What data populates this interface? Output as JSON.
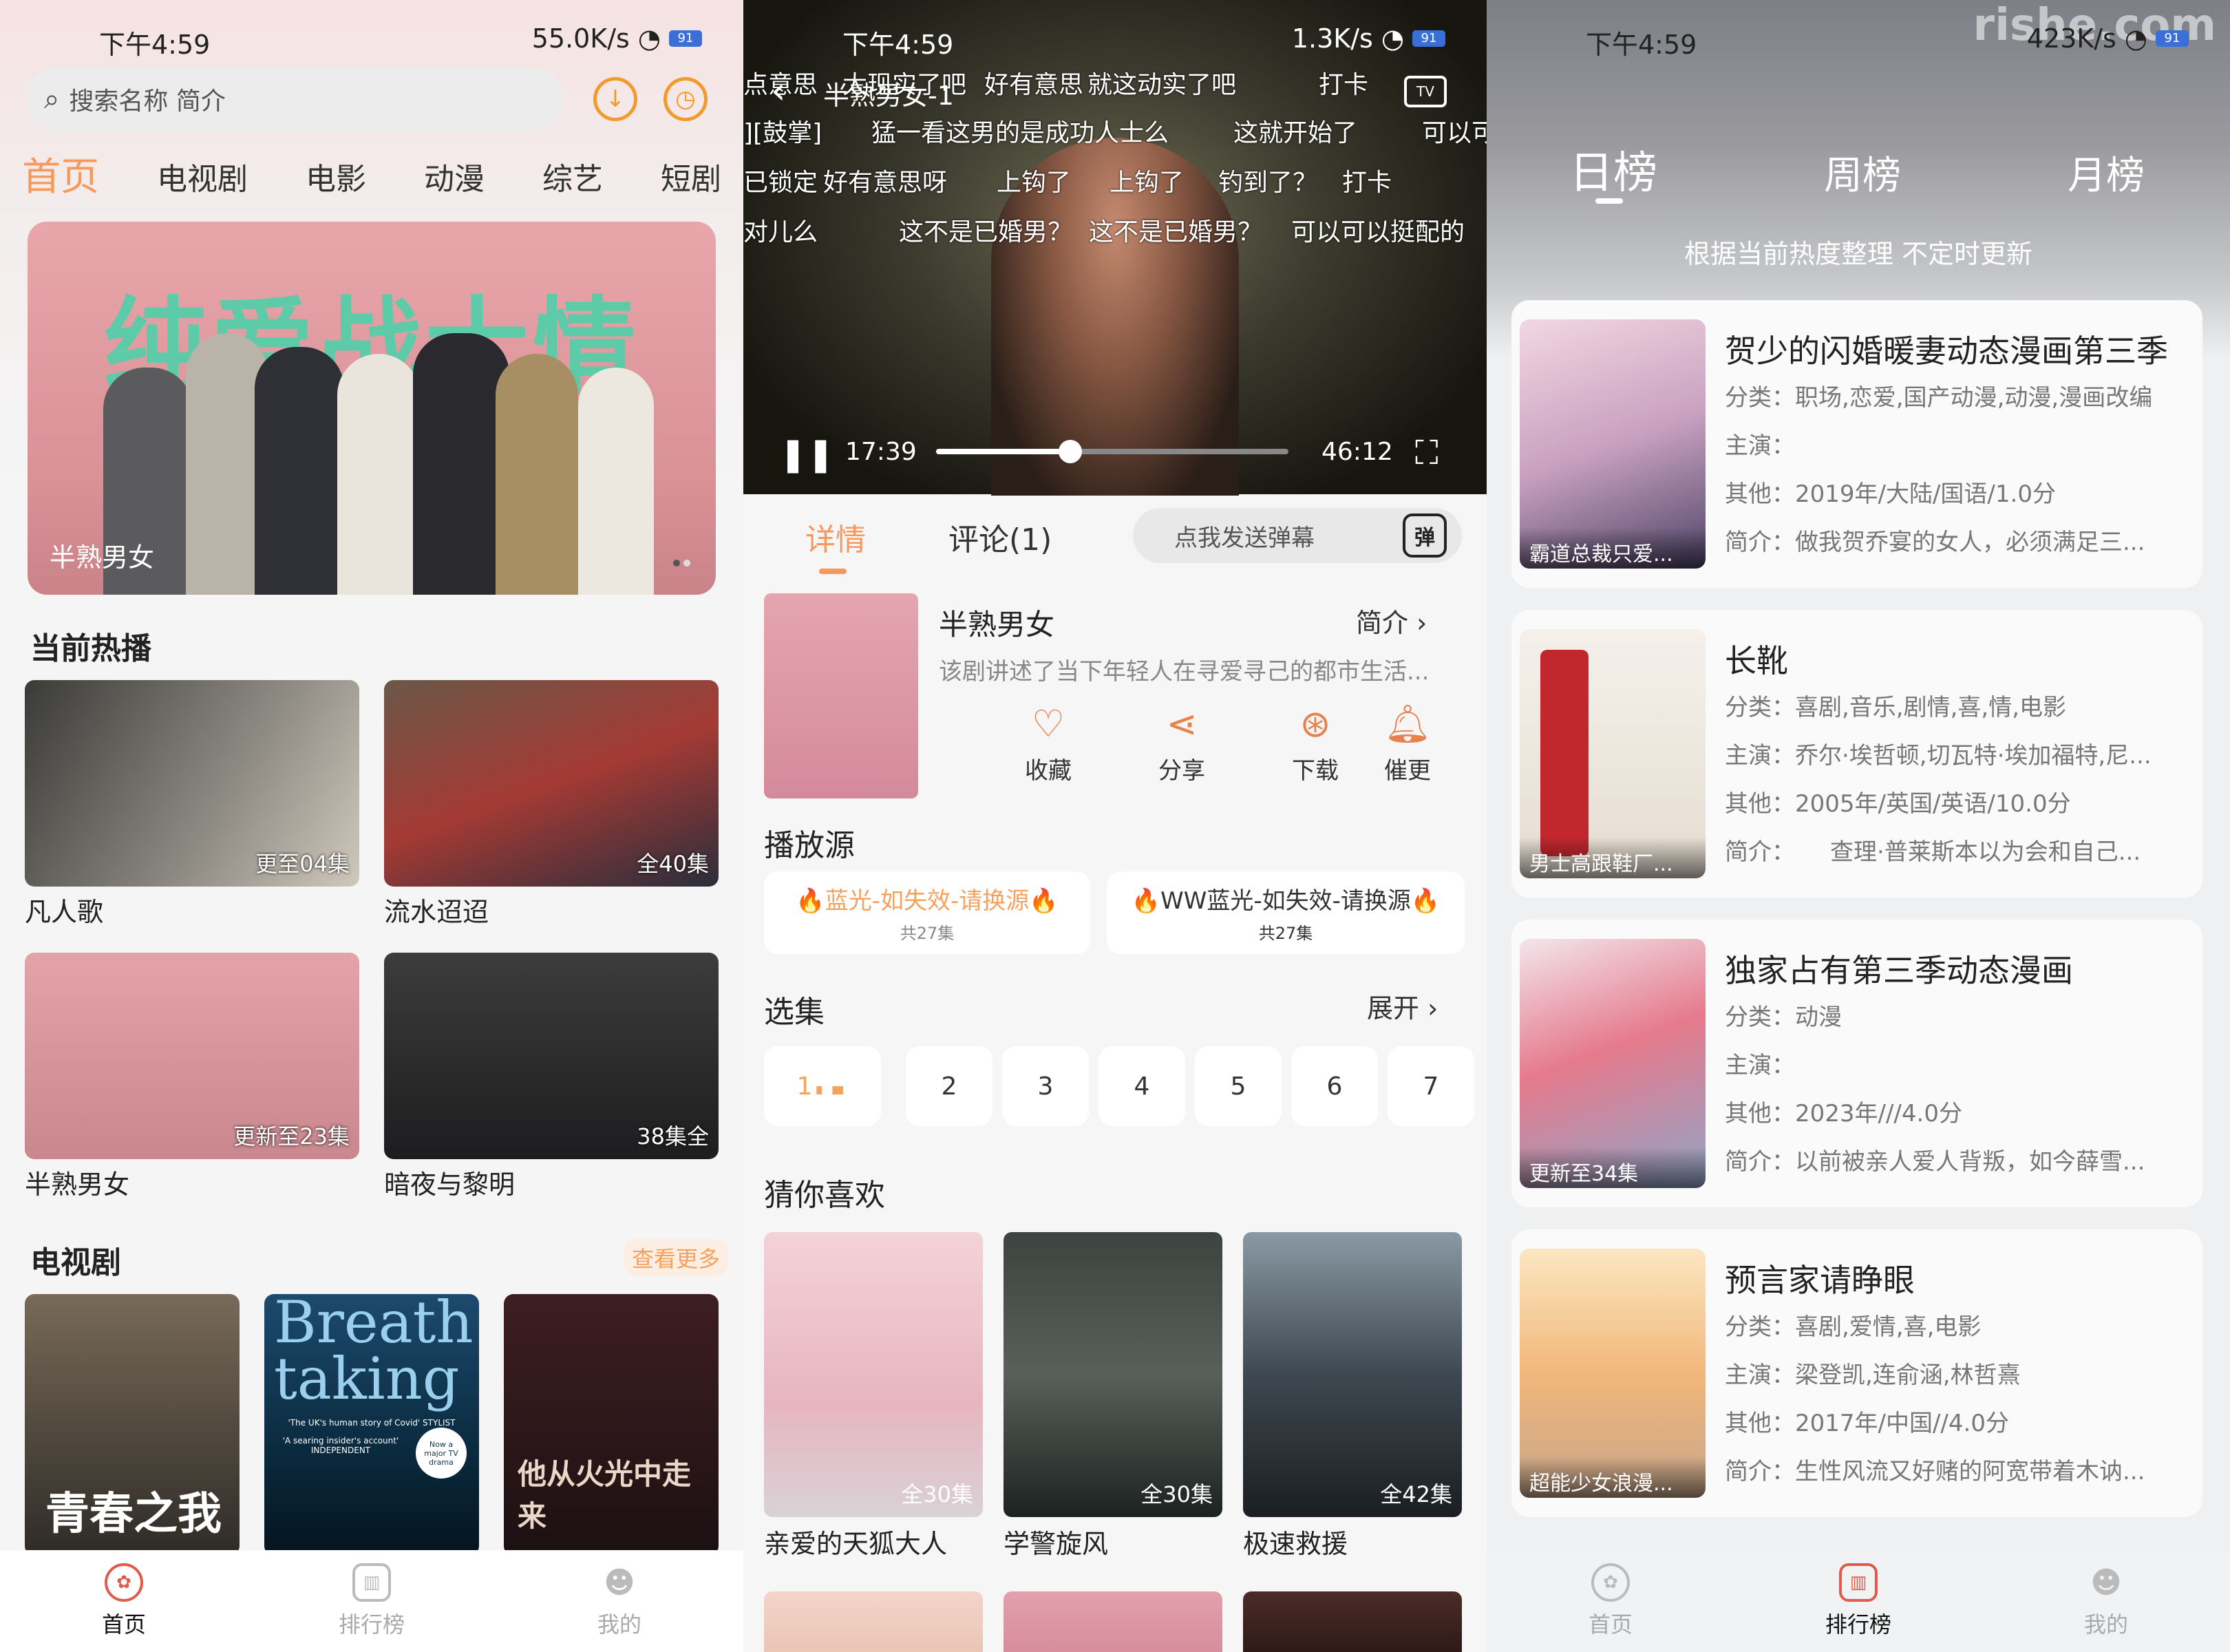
{
  "status": {
    "time": "下午4:59",
    "net1": "55.0K/s",
    "net2": "1.3K/s",
    "net3": "423K/s",
    "battery": "91"
  },
  "home": {
    "search_placeholder": "搜索名称 简介",
    "tabs": [
      "首页",
      "电视剧",
      "电影",
      "动漫",
      "综艺",
      "短剧"
    ],
    "banner_title": "纯爱战士情看",
    "banner_caption": "半熟男女",
    "hot_title": "当前热播",
    "hot": [
      {
        "title": "凡人歌",
        "badge": "更至04集"
      },
      {
        "title": "流水迢迢",
        "badge": "全40集"
      },
      {
        "title": "半熟男女",
        "badge": "更新至23集"
      },
      {
        "title": "暗夜与黎明",
        "badge": "38集全"
      }
    ],
    "tv_title": "电视剧",
    "tv_more": "查看更多",
    "tv_posters": [
      "青春之我",
      "Breath taking",
      "他从火光中走来"
    ],
    "breath_sub": "'The UK's human story of Covid' STYLIST",
    "breath_sub2": "'A searing insider's account' INDEPENDENT",
    "breath_badge": "Now a major TV drama"
  },
  "nav": {
    "home": "首页",
    "rank": "排行榜",
    "mine": "我的"
  },
  "player": {
    "title": "半熟男女-1",
    "danmaku": [
      "点意思",
      "太现实了吧",
      "好有意思",
      "就这动实了吧",
      "打卡",
      "][鼓掌]",
      "猛一看这男的是成功人士么",
      "这就开始了",
      "可以可",
      "已锁定",
      "好有意思呀",
      "上钩了",
      "上钩了",
      "钓到了？",
      "打卡",
      "对儿么",
      "这不是已婚男？",
      "这不是已婚男？",
      "可以可以挺配的"
    ],
    "current": "17:39",
    "total": "46:12",
    "progress": 0.38,
    "tabs": [
      "详情",
      "评论(1)"
    ],
    "danmaku_input": "点我发送弹幕",
    "danmaku_btn": "弹",
    "show_title": "半熟男女",
    "intro_label": "简介",
    "desc": "该剧讲述了当下年轻人在寻爱寻己的都市生活...",
    "actions": [
      "收藏",
      "分享",
      "下载",
      "催更"
    ],
    "source_title": "播放源",
    "sources": [
      {
        "name": "🔥蓝光-如失效-请换源🔥",
        "count": "共27集"
      },
      {
        "name": "🔥WW蓝光-如失效-请换源🔥",
        "count": "共27集"
      }
    ],
    "episodes_title": "选集",
    "expand": "展开",
    "episodes": [
      "1",
      "2",
      "3",
      "4",
      "5",
      "6",
      "7"
    ],
    "guess_title": "猜你喜欢",
    "guess": [
      {
        "title": "亲爱的天狐大人",
        "badge": "全30集"
      },
      {
        "title": "学警旋风",
        "badge": "全30集"
      },
      {
        "title": "极速救援",
        "badge": "全42集"
      }
    ]
  },
  "rank": {
    "tabs": [
      "日榜",
      "周榜",
      "月榜"
    ],
    "subtitle": "根据当前热度整理 不定时更新",
    "items": [
      {
        "title": "贺少的闪婚暖妻动态漫画第三季",
        "cat": "分类：职场,恋爱,国产动漫,动漫,漫画改编",
        "cast": "主演：",
        "other": "其他：2019年/大陆/国语/1.0分",
        "intro": "简介：做我贺乔宴的女人，必须满足三...",
        "cover": "霸道总裁只爱..."
      },
      {
        "title": "长靴",
        "cat": "分类：喜剧,音乐,剧情,喜,情,电影",
        "cast": "主演：乔尔·埃哲顿,切瓦特·埃加福特,尼...",
        "other": "其他：2005年/英国/英语/10.0分",
        "intro": "简介：　　查理·普莱斯本以为会和自己...",
        "cover": "男士高跟鞋厂..."
      },
      {
        "title": "独家占有第三季动态漫画",
        "cat": "分类：动漫",
        "cast": "主演：",
        "other": "其他：2023年///4.0分",
        "intro": "简介：以前被亲人爱人背叛，如今薛雪...",
        "cover": "更新至34集"
      },
      {
        "title": "预言家请睁眼",
        "cat": "分类：喜剧,爱情,喜,电影",
        "cast": "主演：梁登凯,连俞涵,林哲熹",
        "other": "其他：2017年/中国//4.0分",
        "intro": "简介：生性风流又好赌的阿宽带着木讷...",
        "cover": "超能少女浪漫..."
      }
    ]
  },
  "watermark": "rishe.com"
}
